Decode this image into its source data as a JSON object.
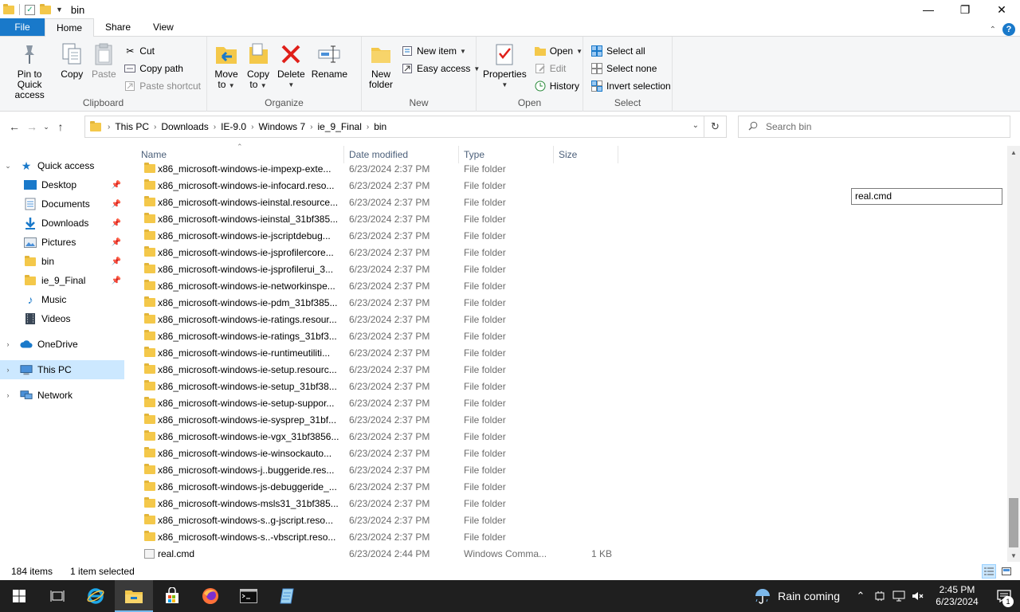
{
  "window": {
    "title": "bin"
  },
  "ribbon_tabs": {
    "file": "File",
    "home": "Home",
    "share": "Share",
    "view": "View"
  },
  "ribbon": {
    "clipboard": {
      "label": "Clipboard",
      "pin_line1": "Pin to Quick",
      "pin_line2": "access",
      "copy": "Copy",
      "paste": "Paste",
      "cut": "Cut",
      "copy_path": "Copy path",
      "paste_shortcut": "Paste shortcut"
    },
    "organize": {
      "label": "Organize",
      "move_line1": "Move",
      "move_line2": "to",
      "copy_line1": "Copy",
      "copy_line2": "to",
      "delete": "Delete",
      "rename": "Rename"
    },
    "new": {
      "label": "New",
      "folder_line1": "New",
      "folder_line2": "folder",
      "new_item": "New item",
      "easy_access": "Easy access"
    },
    "open": {
      "label": "Open",
      "properties": "Properties",
      "open": "Open",
      "edit": "Edit",
      "history": "History"
    },
    "select": {
      "label": "Select",
      "select_all": "Select all",
      "select_none": "Select none",
      "invert": "Invert selection"
    }
  },
  "address": {
    "crumbs": [
      "This PC",
      "Downloads",
      "IE-9.0",
      "Windows 7",
      "ie_9_Final",
      "bin"
    ],
    "search_placeholder": "Search bin"
  },
  "nav": {
    "quick_access": "Quick access",
    "desktop": "Desktop",
    "documents": "Documents",
    "downloads": "Downloads",
    "pictures": "Pictures",
    "bin": "bin",
    "ie9final": "ie_9_Final",
    "music": "Music",
    "videos": "Videos",
    "onedrive": "OneDrive",
    "thispc": "This PC",
    "network": "Network"
  },
  "columns": {
    "name": "Name",
    "date": "Date modified",
    "type": "Type",
    "size": "Size"
  },
  "files": [
    {
      "name": "x86_microsoft-windows-ie-impexp-exte...",
      "date": "6/23/2024 2:37 PM",
      "type": "File folder",
      "size": ""
    },
    {
      "name": "x86_microsoft-windows-ie-infocard.reso...",
      "date": "6/23/2024 2:37 PM",
      "type": "File folder",
      "size": ""
    },
    {
      "name": "x86_microsoft-windows-ieinstal.resource...",
      "date": "6/23/2024 2:37 PM",
      "type": "File folder",
      "size": ""
    },
    {
      "name": "x86_microsoft-windows-ieinstal_31bf385...",
      "date": "6/23/2024 2:37 PM",
      "type": "File folder",
      "size": ""
    },
    {
      "name": "x86_microsoft-windows-ie-jscriptdebug...",
      "date": "6/23/2024 2:37 PM",
      "type": "File folder",
      "size": ""
    },
    {
      "name": "x86_microsoft-windows-ie-jsprofilercore...",
      "date": "6/23/2024 2:37 PM",
      "type": "File folder",
      "size": ""
    },
    {
      "name": "x86_microsoft-windows-ie-jsprofilerui_3...",
      "date": "6/23/2024 2:37 PM",
      "type": "File folder",
      "size": ""
    },
    {
      "name": "x86_microsoft-windows-ie-networkinspe...",
      "date": "6/23/2024 2:37 PM",
      "type": "File folder",
      "size": ""
    },
    {
      "name": "x86_microsoft-windows-ie-pdm_31bf385...",
      "date": "6/23/2024 2:37 PM",
      "type": "File folder",
      "size": ""
    },
    {
      "name": "x86_microsoft-windows-ie-ratings.resour...",
      "date": "6/23/2024 2:37 PM",
      "type": "File folder",
      "size": ""
    },
    {
      "name": "x86_microsoft-windows-ie-ratings_31bf3...",
      "date": "6/23/2024 2:37 PM",
      "type": "File folder",
      "size": ""
    },
    {
      "name": "x86_microsoft-windows-ie-runtimeutiliti...",
      "date": "6/23/2024 2:37 PM",
      "type": "File folder",
      "size": ""
    },
    {
      "name": "x86_microsoft-windows-ie-setup.resourc...",
      "date": "6/23/2024 2:37 PM",
      "type": "File folder",
      "size": ""
    },
    {
      "name": "x86_microsoft-windows-ie-setup_31bf38...",
      "date": "6/23/2024 2:37 PM",
      "type": "File folder",
      "size": ""
    },
    {
      "name": "x86_microsoft-windows-ie-setup-suppor...",
      "date": "6/23/2024 2:37 PM",
      "type": "File folder",
      "size": ""
    },
    {
      "name": "x86_microsoft-windows-ie-sysprep_31bf...",
      "date": "6/23/2024 2:37 PM",
      "type": "File folder",
      "size": ""
    },
    {
      "name": "x86_microsoft-windows-ie-vgx_31bf3856...",
      "date": "6/23/2024 2:37 PM",
      "type": "File folder",
      "size": ""
    },
    {
      "name": "x86_microsoft-windows-ie-winsockauto...",
      "date": "6/23/2024 2:37 PM",
      "type": "File folder",
      "size": ""
    },
    {
      "name": "x86_microsoft-windows-j..buggeride.res...",
      "date": "6/23/2024 2:37 PM",
      "type": "File folder",
      "size": ""
    },
    {
      "name": "x86_microsoft-windows-js-debuggeride_...",
      "date": "6/23/2024 2:37 PM",
      "type": "File folder",
      "size": ""
    },
    {
      "name": "x86_microsoft-windows-msls31_31bf385...",
      "date": "6/23/2024 2:37 PM",
      "type": "File folder",
      "size": ""
    },
    {
      "name": "x86_microsoft-windows-s..g-jscript.reso...",
      "date": "6/23/2024 2:37 PM",
      "type": "File folder",
      "size": ""
    },
    {
      "name": "x86_microsoft-windows-s..-vbscript.reso...",
      "date": "6/23/2024 2:37 PM",
      "type": "File folder",
      "size": ""
    },
    {
      "name": "real.cmd",
      "date": "6/23/2024 2:44 PM",
      "type": "Windows Comma...",
      "size": "1 KB"
    }
  ],
  "rename": {
    "value": "real.cmd"
  },
  "status": {
    "count": "184 items",
    "selected": "1 item selected"
  },
  "taskbar": {
    "weather": "Rain coming",
    "time": "2:45 PM",
    "date": "6/23/2024",
    "notifications": "1"
  }
}
